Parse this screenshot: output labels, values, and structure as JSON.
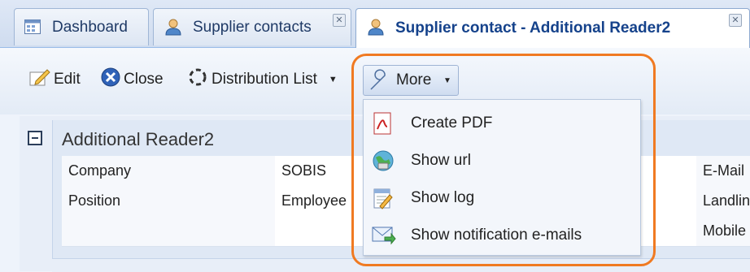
{
  "tabs": [
    {
      "label": "Dashboard",
      "icon": "dashboard-icon",
      "closable": false
    },
    {
      "label": "Supplier contacts",
      "icon": "contact-icon",
      "closable": true
    },
    {
      "label": "Supplier contact - Additional Reader2",
      "icon": "contact-icon",
      "closable": true,
      "active": true
    }
  ],
  "toolbar": {
    "edit_label": "Edit",
    "close_label": "Close",
    "distribution_label": "Distribution List",
    "more_label": "More"
  },
  "section": {
    "title": "Additional Reader2",
    "rows": [
      {
        "label": "Company",
        "value": "SOBIS",
        "right_label": "E-Mail"
      },
      {
        "label": "Position",
        "value": "Employee",
        "right_label": "Landline"
      },
      {
        "label": "",
        "value": "",
        "right_label": "Mobile"
      }
    ]
  },
  "more_menu": [
    {
      "label": "Create PDF",
      "icon": "pdf-icon"
    },
    {
      "label": "Show url",
      "icon": "globe-icon"
    },
    {
      "label": "Show log",
      "icon": "log-icon"
    },
    {
      "label": "Show notification e-mails",
      "icon": "envelope-icon"
    }
  ],
  "colors": {
    "highlight": "#f07a22",
    "active_tab_text": "#15428b"
  }
}
